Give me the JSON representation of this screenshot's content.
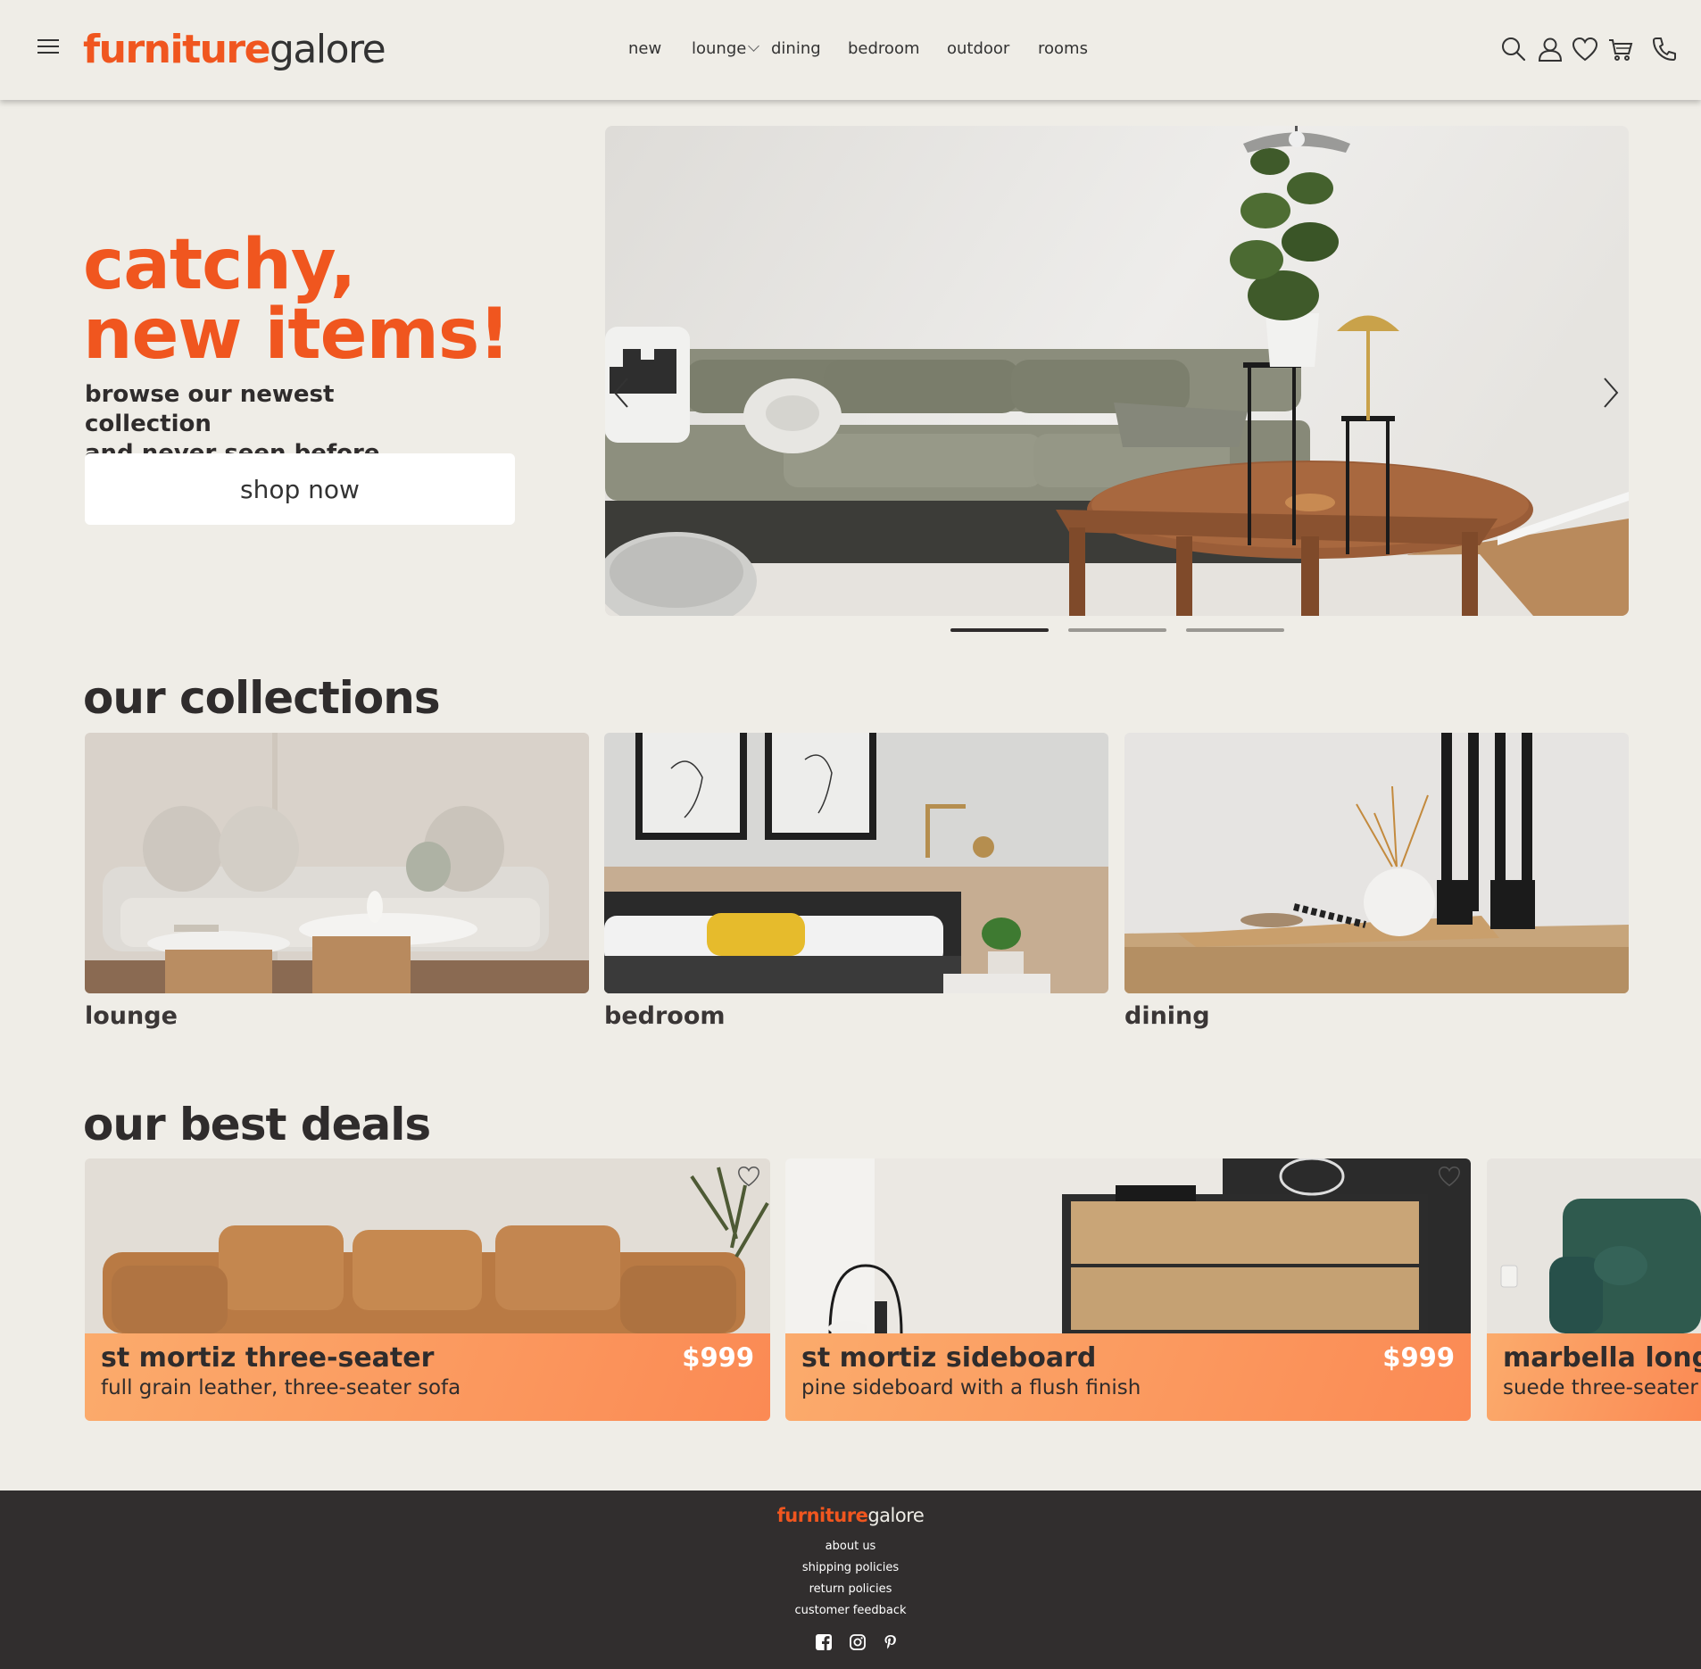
{
  "brand": {
    "part1": "furniture",
    "part2": "galore",
    "accent_color": "#f0561f"
  },
  "nav": {
    "new": "new",
    "lounge": "lounge",
    "dining": "dining",
    "bedroom": "bedroom",
    "outdoor": "outdoor",
    "rooms": "rooms"
  },
  "header_icons": [
    "search-icon",
    "user-icon",
    "heart-icon",
    "cart-icon",
    "phone-icon"
  ],
  "hero": {
    "title_line1": "catchy,",
    "title_line2": "new items!",
    "subtitle_line1": "browse our newest collection",
    "subtitle_line2": "and never seen before deals!",
    "cta": "shop now",
    "slides_total": 3,
    "active_slide": 1
  },
  "collections": {
    "title": "our collections",
    "items": [
      {
        "label": "lounge"
      },
      {
        "label": "bedroom"
      },
      {
        "label": "dining"
      }
    ]
  },
  "deals": {
    "title": "our best deals",
    "items": [
      {
        "name": "st mortiz three-seater",
        "description": "full grain leather, three-seater sofa",
        "price": "$999"
      },
      {
        "name": "st mortiz sideboard",
        "description": "pine sideboard with a flush finish",
        "price": "$999"
      },
      {
        "name": "marbella longbo",
        "description": "suede three-seater s",
        "price": ""
      }
    ]
  },
  "footer": {
    "links": [
      "about us",
      "shipping policies",
      "return policies",
      "customer feedback"
    ],
    "social": [
      "facebook-icon",
      "instagram-icon",
      "pinterest-icon"
    ]
  }
}
